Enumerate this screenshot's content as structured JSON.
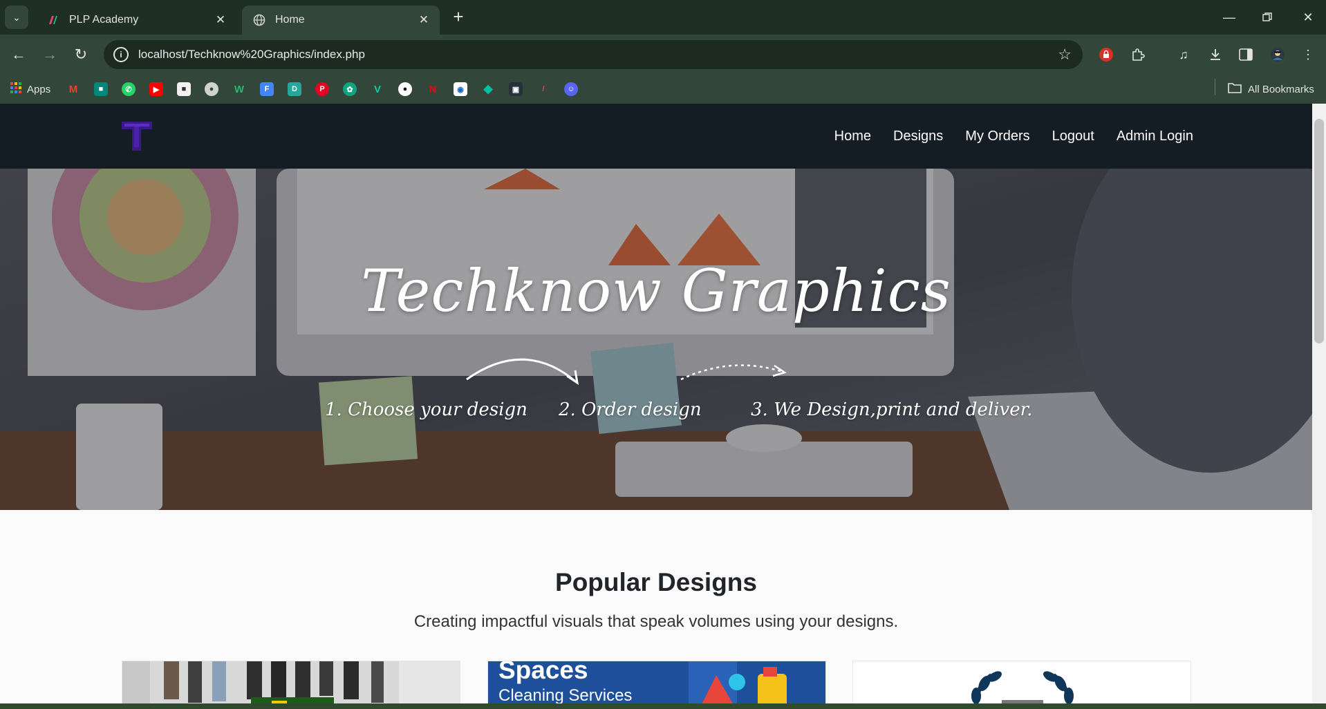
{
  "browser": {
    "tabs": [
      {
        "title": "PLP Academy",
        "active": false
      },
      {
        "title": "Home",
        "active": true
      }
    ],
    "url": "localhost/Techknow%20Graphics/index.php",
    "bookmarks_label": "Apps",
    "all_bookmarks_label": "All Bookmarks",
    "bookmark_icons": [
      "gmail",
      "meet",
      "whatsapp",
      "youtube",
      "photo",
      "globe",
      "webflow",
      "forms",
      "docs",
      "pinterest",
      "chatgpt",
      "vectary",
      "github",
      "netflix",
      "dribbble",
      "diamond",
      "tablet",
      "plp",
      "discord"
    ]
  },
  "site": {
    "nav": {
      "items": [
        "Home",
        "Designs",
        "My Orders",
        "Logout",
        "Admin Login"
      ]
    },
    "hero": {
      "title": "Techknow Graphics",
      "steps": [
        "1. Choose your design",
        "2. Order design",
        "3. We Design,print and deliver."
      ]
    },
    "popular": {
      "title": "Popular Designs",
      "subtitle": "Creating impactful visuals that speak volumes using your designs."
    },
    "cards": [
      {
        "alt": "group-photo-design"
      },
      {
        "caption_top": "Spaces",
        "caption_bottom": "Cleaning Services"
      },
      {
        "alt": "laurel-emblem-design"
      }
    ]
  },
  "colors": {
    "tabstrip": "#1f2f22",
    "toolbar": "#33463a",
    "site_nav": "#141c24",
    "logo": "#3a1a8a"
  }
}
